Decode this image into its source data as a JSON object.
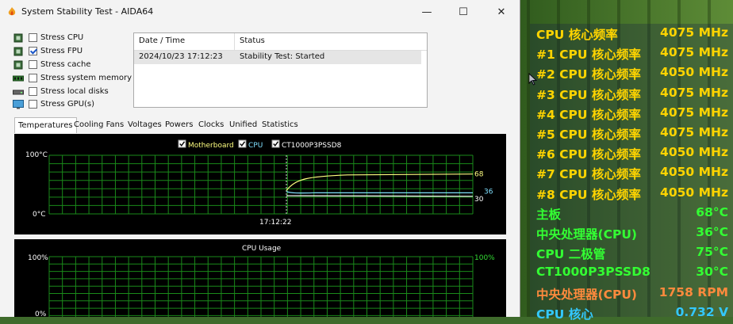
{
  "window": {
    "title": "System Stability Test - AIDA64",
    "controls": {
      "minimize": "—",
      "maximize": "☐",
      "close": "✕"
    }
  },
  "stress_options": [
    {
      "label": "Stress CPU",
      "checked": false,
      "icon": "cpu-chip-icon"
    },
    {
      "label": "Stress FPU",
      "checked": true,
      "icon": "fpu-chip-icon"
    },
    {
      "label": "Stress cache",
      "checked": false,
      "icon": "cache-chip-icon"
    },
    {
      "label": "Stress system memory",
      "checked": false,
      "icon": "memory-module-icon"
    },
    {
      "label": "Stress local disks",
      "checked": false,
      "icon": "disk-drive-icon"
    },
    {
      "label": "Stress GPU(s)",
      "checked": false,
      "icon": "monitor-icon"
    }
  ],
  "log": {
    "headers": {
      "datetime": "Date / Time",
      "status": "Status"
    },
    "rows": [
      {
        "datetime": "2024/10/23 17:12:23",
        "status": "Stability Test: Started"
      }
    ]
  },
  "tabs": [
    "Temperatures",
    "Cooling Fans",
    "Voltages",
    "Powers",
    "Clocks",
    "Unified",
    "Statistics"
  ],
  "temperature_graph": {
    "legend": [
      {
        "label": "Motherboard",
        "checked": true,
        "color": "#ffff80"
      },
      {
        "label": "CPU",
        "checked": true,
        "color": "#80e0ff"
      },
      {
        "label": "CT1000P3PSSD8",
        "checked": true,
        "color": "#ffffff"
      }
    ],
    "y_max_label": "100°C",
    "y_min_label": "0°C",
    "time_label": "17:12:22",
    "series_values": {
      "motherboard": "68",
      "ssd": "30",
      "cpu": "36"
    },
    "colors": {
      "grid": "#1a8a1a",
      "motherboard": "#ffff80",
      "cpu": "#80e0ff",
      "ssd": "#ffffff"
    }
  },
  "cpu_usage_graph": {
    "title": "CPU Usage",
    "y_max_label": "100%",
    "y_min_label": "0%",
    "right_max_label": "100%",
    "color": "#33dd33"
  },
  "sensor_overlay": [
    {
      "label": "CPU 核心频率",
      "value": "4075 MHz",
      "color": "#ffd400"
    },
    {
      "label": "#1 CPU 核心频率",
      "value": "4075 MHz",
      "color": "#ffd400"
    },
    {
      "label": "#2 CPU 核心频率",
      "value": "4050 MHz",
      "color": "#ffd400"
    },
    {
      "label": "#3 CPU 核心频率",
      "value": "4075 MHz",
      "color": "#ffd400"
    },
    {
      "label": "#4 CPU 核心频率",
      "value": "4075 MHz",
      "color": "#ffd400"
    },
    {
      "label": "#5 CPU 核心频率",
      "value": "4075 MHz",
      "color": "#ffd400"
    },
    {
      "label": "#6 CPU 核心频率",
      "value": "4050 MHz",
      "color": "#ffd400"
    },
    {
      "label": "#7 CPU 核心频率",
      "value": "4050 MHz",
      "color": "#ffd400"
    },
    {
      "label": "#8 CPU 核心频率",
      "value": "4050 MHz",
      "color": "#ffd400"
    },
    {
      "label": "主板",
      "value": "68°C",
      "color": "#33ff33"
    },
    {
      "label": "中央处理器(CPU)",
      "value": "36°C",
      "color": "#33ff33"
    },
    {
      "label": "CPU 二极管",
      "value": "75°C",
      "color": "#33ff33"
    },
    {
      "label": "CT1000P3PSSD8",
      "value": "30°C",
      "color": "#33ff33"
    },
    {
      "label": "中央处理器(CPU)",
      "value": "1758 RPM",
      "color": "#ff8a3d"
    },
    {
      "label": "CPU 核心",
      "value": "0.732 V",
      "color": "#33c8ff"
    }
  ]
}
